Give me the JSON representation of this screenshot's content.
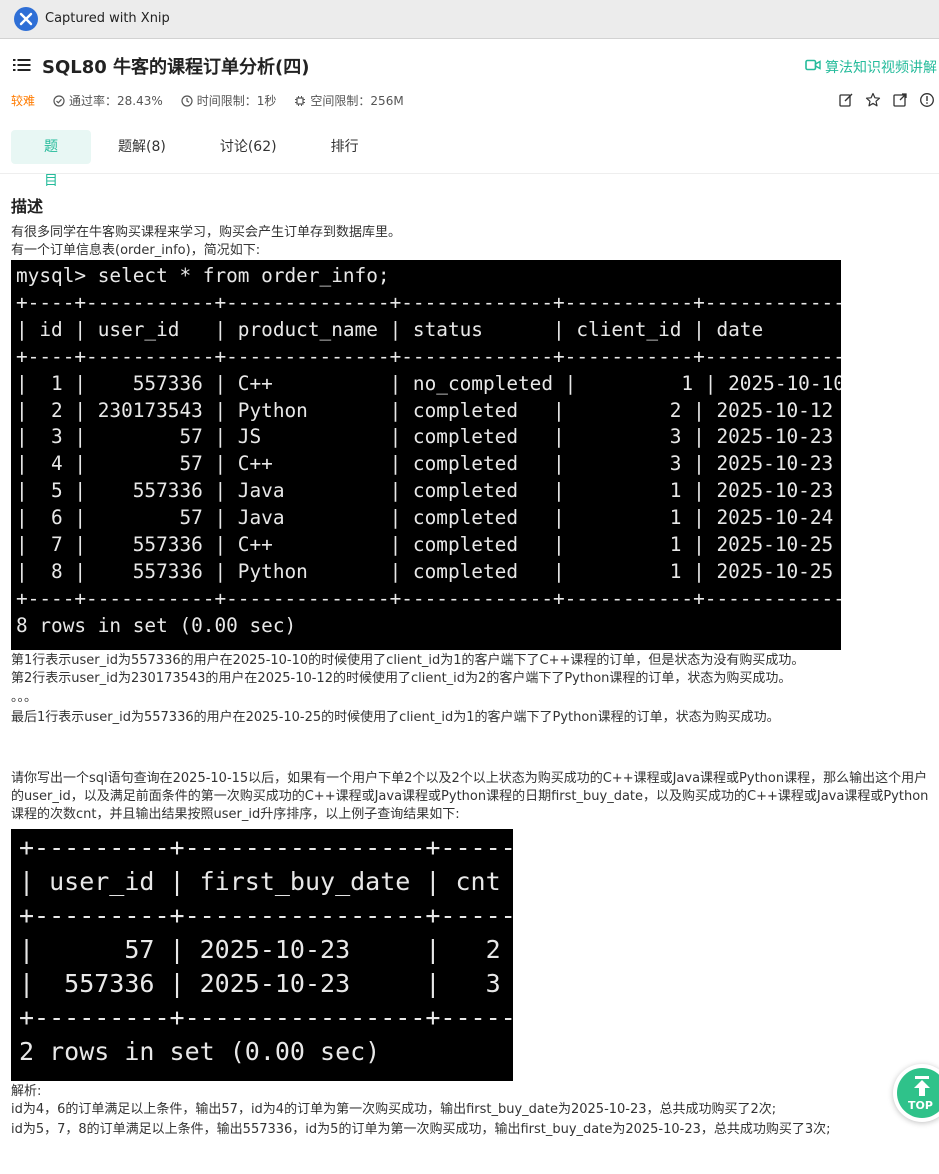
{
  "window": {
    "title": "Captured with Xnip"
  },
  "problem": {
    "title": "SQL80  牛客的课程订单分析(四)",
    "video_link": "算法知识视频讲解",
    "difficulty": "较难",
    "pass_rate": "通过率：28.43%",
    "time_limit": "时间限制：1秒",
    "space_limit": "空间限制：256M"
  },
  "tabs": [
    {
      "label": "题目"
    },
    {
      "label": "题解(8)"
    },
    {
      "label": "讨论(62)"
    },
    {
      "label": "排行"
    }
  ],
  "content": {
    "section_title": "描述",
    "intro_1": "有很多同学在牛客购买课程来学习，购买会产生订单存到数据库里。",
    "intro_2": "有一个订单信息表(order_info)，简况如下:",
    "term1_text": "mysql> select * from order_info;\n+----+-----------+--------------+-------------+-----------+------------+\n| id | user_id   | product_name | status      | client_id | date       |\n+----+-----------+--------------+-------------+-----------+------------+\n|  1 |    557336 | C++          | no_completed |         1 | 2025-10-10 |\n|  2 | 230173543 | Python       | completed   |         2 | 2025-10-12 |\n|  3 |        57 | JS           | completed   |         3 | 2025-10-23 |\n|  4 |        57 | C++          | completed   |         3 | 2025-10-23 |\n|  5 |    557336 | Java         | completed   |         1 | 2025-10-23 |\n|  6 |        57 | Java         | completed   |         1 | 2025-10-24 |\n|  7 |    557336 | C++          | completed   |         1 | 2025-10-25 |\n|  8 |    557336 | Python       | completed   |         1 | 2025-10-25 |\n+----+-----------+--------------+-------------+-----------+------------+\n8 rows in set (0.00 sec)",
    "row_note_1": "第1行表示user_id为557336的用户在2025-10-10的时候使用了client_id为1的客户端下了C++课程的订单，但是状态为没有购买成功。",
    "row_note_2": "第2行表示user_id为230173543的用户在2025-10-12的时候使用了client_id为2的客户端下了Python课程的订单，状态为购买成功。",
    "ellipsis": "。。。",
    "row_note_last": "最后1行表示user_id为557336的用户在2025-10-25的时候使用了client_id为1的客户端下了Python课程的订单，状态为购买成功。",
    "question": "请你写出一个sql语句查询在2025-10-15以后，如果有一个用户下单2个以及2个以上状态为购买成功的C++课程或Java课程或Python课程，那么输出这个用户的user_id，以及满足前面条件的第一次购买成功的C++课程或Java课程或Python课程的日期first_buy_date，以及购买成功的C++课程或Java课程或Python课程的次数cnt，并且输出结果按照user_id升序排序，以上例子查询结果如下:",
    "term2_text": "+---------+----------------+-----+\n| user_id | first_buy_date | cnt |\n+---------+----------------+-----+\n|      57 | 2025-10-23     |   2 |\n|  557336 | 2025-10-23     |   3 |\n+---------+----------------+-----+\n2 rows in set (0.00 sec)",
    "analysis_label": "解析:",
    "analysis_1": "id为4，6的订单满足以上条件，输出57，id为4的订单为第一次购买成功，输出first_buy_date为2025-10-23，总共成功购买了2次;",
    "analysis_2": "id为5，7，8的订单满足以上条件，输出557336，id为5的订单为第一次购买成功，输出first_buy_date为2025-10-23，总共成功购买了3次;"
  },
  "top_button": {
    "label": "TOP"
  },
  "colors": {
    "accent": "#25bb9b",
    "difficulty": "#ff7b00",
    "top_button": "#2fc28a"
  }
}
